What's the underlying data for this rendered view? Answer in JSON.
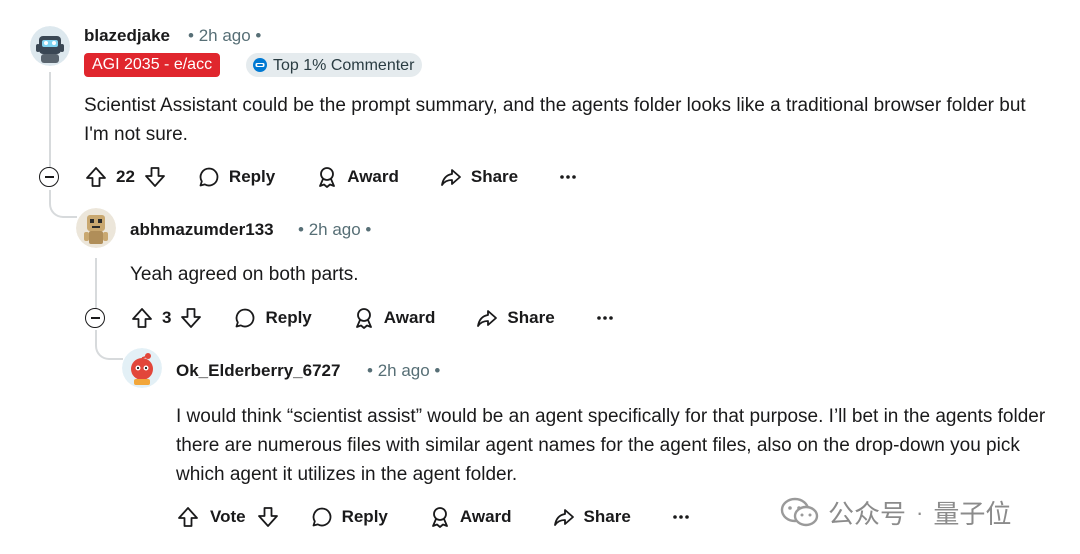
{
  "comments": [
    {
      "username": "blazedjake",
      "time": "2h ago",
      "flair": "AGI 2035 - e/acc",
      "badge": "Top 1% Commenter",
      "body": "Scientist Assistant could be the prompt summary, and the agents folder looks like a traditional browser folder but I'm not sure.",
      "votes": "22",
      "reply_label": "Reply",
      "award_label": "Award",
      "share_label": "Share"
    },
    {
      "username": "abhmazumder133",
      "time": "2h ago",
      "body": "Yeah agreed on both parts.",
      "votes": "3",
      "reply_label": "Reply",
      "award_label": "Award",
      "share_label": "Share"
    },
    {
      "username": "Ok_Elderberry_6727",
      "time": "2h ago",
      "body": "I would think “scientist assist” would be an agent specifically for that purpose. I’ll bet in the agents folder there are numerous files with similar agent names for the agent files, also on the drop-down you pick which agent it utilizes in the agent folder.",
      "votes": "Vote",
      "reply_label": "Reply",
      "award_label": "Award",
      "share_label": "Share"
    }
  ],
  "watermark": {
    "account": "公众号",
    "name": "量子位"
  },
  "colors": {
    "flair_red": "#e0262d",
    "badge_bg": "#e5ebee",
    "meta": "#576f76",
    "thread_line": "#d7dadc"
  }
}
